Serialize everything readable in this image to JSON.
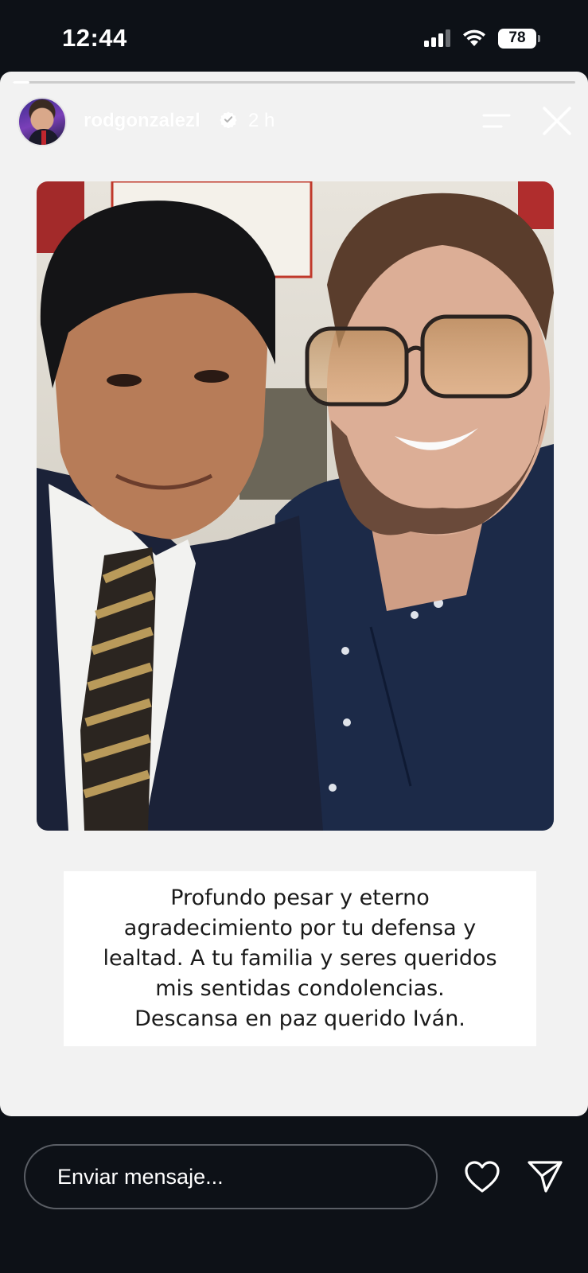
{
  "status_bar": {
    "time": "12:44",
    "battery": "78"
  },
  "story": {
    "progress_fraction": 0.03,
    "username": "rodgonzalezl",
    "verified": true,
    "time_ago": "2 h",
    "caption": "Profundo pesar  y eterno\nagradecimiento por tu defensa y\nlealtad. A tu familia y seres queridos\nmis sentidas condolencias.\nDescansa en paz querido Iván."
  },
  "reply": {
    "placeholder": "Enviar mensaje..."
  },
  "colors": {
    "background": "#0d1117",
    "story_background": "#f2f2f2"
  }
}
